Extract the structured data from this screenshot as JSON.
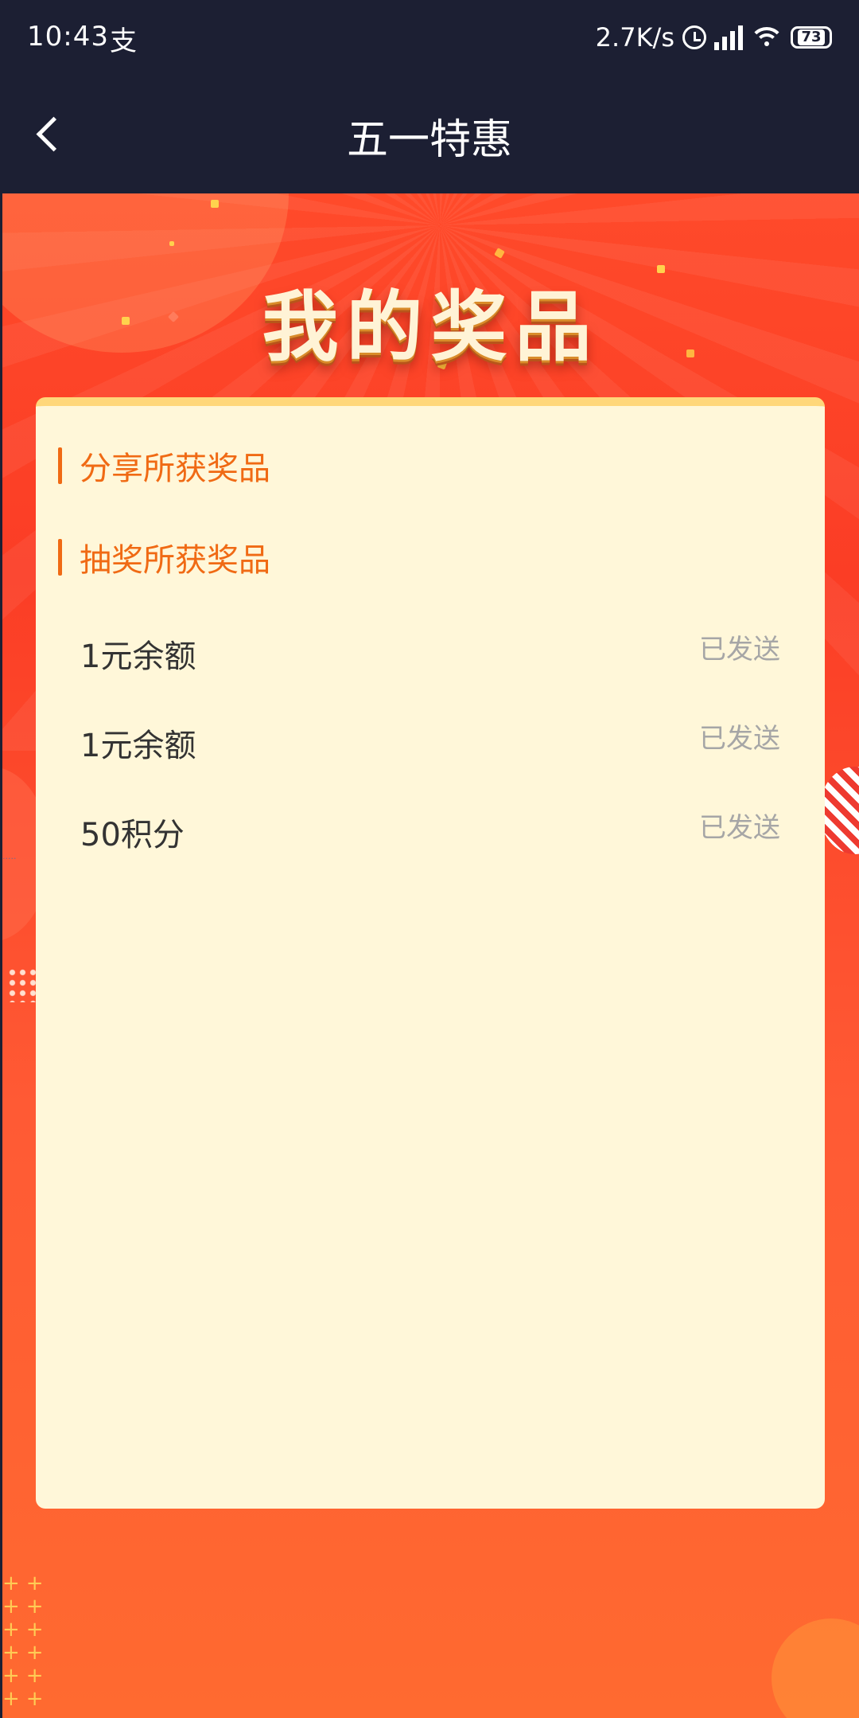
{
  "status_bar": {
    "time": "10:43",
    "notification_icon": "alipay-icon",
    "network_speed": "2.7K/s",
    "battery": "73"
  },
  "nav": {
    "title": "五一特惠"
  },
  "banner": {
    "title": "我的奖品"
  },
  "sections": [
    {
      "label": "分享所获奖品"
    },
    {
      "label": "抽奖所获奖品"
    }
  ],
  "prizes": [
    {
      "name": "1元余额",
      "status": "已发送"
    },
    {
      "name": "1元余额",
      "status": "已发送"
    },
    {
      "name": "50积分",
      "status": "已发送"
    }
  ],
  "colors": {
    "accent": "#f06a14",
    "card_bg": "#fff7d9",
    "header_bg": "#1c1f33"
  }
}
